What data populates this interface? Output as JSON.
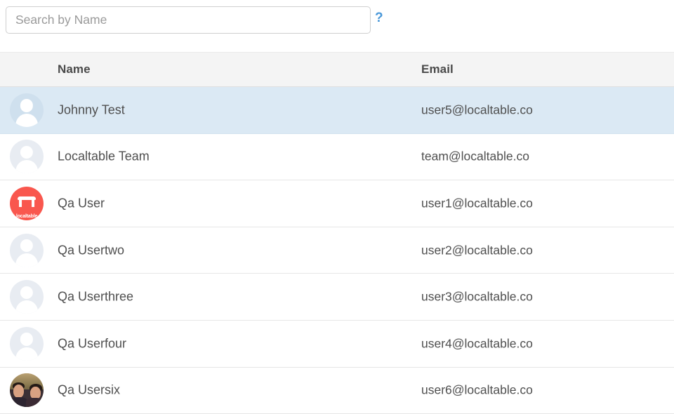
{
  "search": {
    "placeholder": "Search by Name",
    "value": "",
    "help_label": "?",
    "help_color": "#4a98d9"
  },
  "table": {
    "columns": [
      {
        "key": "name",
        "label": "Name"
      },
      {
        "key": "email",
        "label": "Email"
      }
    ],
    "selected_row_color": "#dbe9f4",
    "header_background": "#f4f4f4",
    "rows": [
      {
        "name": "Johnny Test",
        "email": "user5@localtable.co",
        "avatar": "default-person-avatar",
        "selected": true
      },
      {
        "name": "Localtable Team",
        "email": "team@localtable.co",
        "avatar": "default-person-avatar",
        "selected": false
      },
      {
        "name": "Qa User",
        "email": "user1@localtable.co",
        "avatar": "localtable-logo-avatar",
        "avatar_wordmark": "localtable",
        "avatar_color": "#f9574e",
        "selected": false
      },
      {
        "name": "Qa Usertwo",
        "email": "user2@localtable.co",
        "avatar": "default-person-avatar",
        "selected": false
      },
      {
        "name": "Qa Userthree",
        "email": "user3@localtable.co",
        "avatar": "default-person-avatar",
        "selected": false
      },
      {
        "name": "Qa Userfour",
        "email": "user4@localtable.co",
        "avatar": "default-person-avatar",
        "selected": false
      },
      {
        "name": "Qa Usersix",
        "email": "user6@localtable.co",
        "avatar": "photo-avatar",
        "selected": false
      }
    ]
  }
}
